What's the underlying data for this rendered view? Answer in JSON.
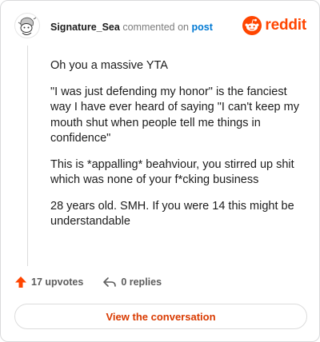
{
  "comment": {
    "username": "Signature_Sea",
    "action_text": "commented on",
    "post_link": "post",
    "paragraphs": [
      "Oh you a massive YTA",
      "\"I was just defending my honor\" is the fanciest way I have ever heard of saying \"I can't keep my mouth shut when people tell me things in confidence\"",
      "This is *appalling* beahviour, you stirred up shit which was none of your f*cking business",
      "28 years old. SMH. If you were 14 this might be understandable"
    ],
    "upvotes_label": "17 upvotes",
    "replies_label": "0 replies"
  },
  "brand": {
    "wordmark": "reddit",
    "color": "#ff4500"
  },
  "cta": {
    "label": "View the conversation"
  },
  "colors": {
    "link": "#0079d3",
    "upvote": "#ff4500",
    "cta_text": "#d93a00"
  }
}
